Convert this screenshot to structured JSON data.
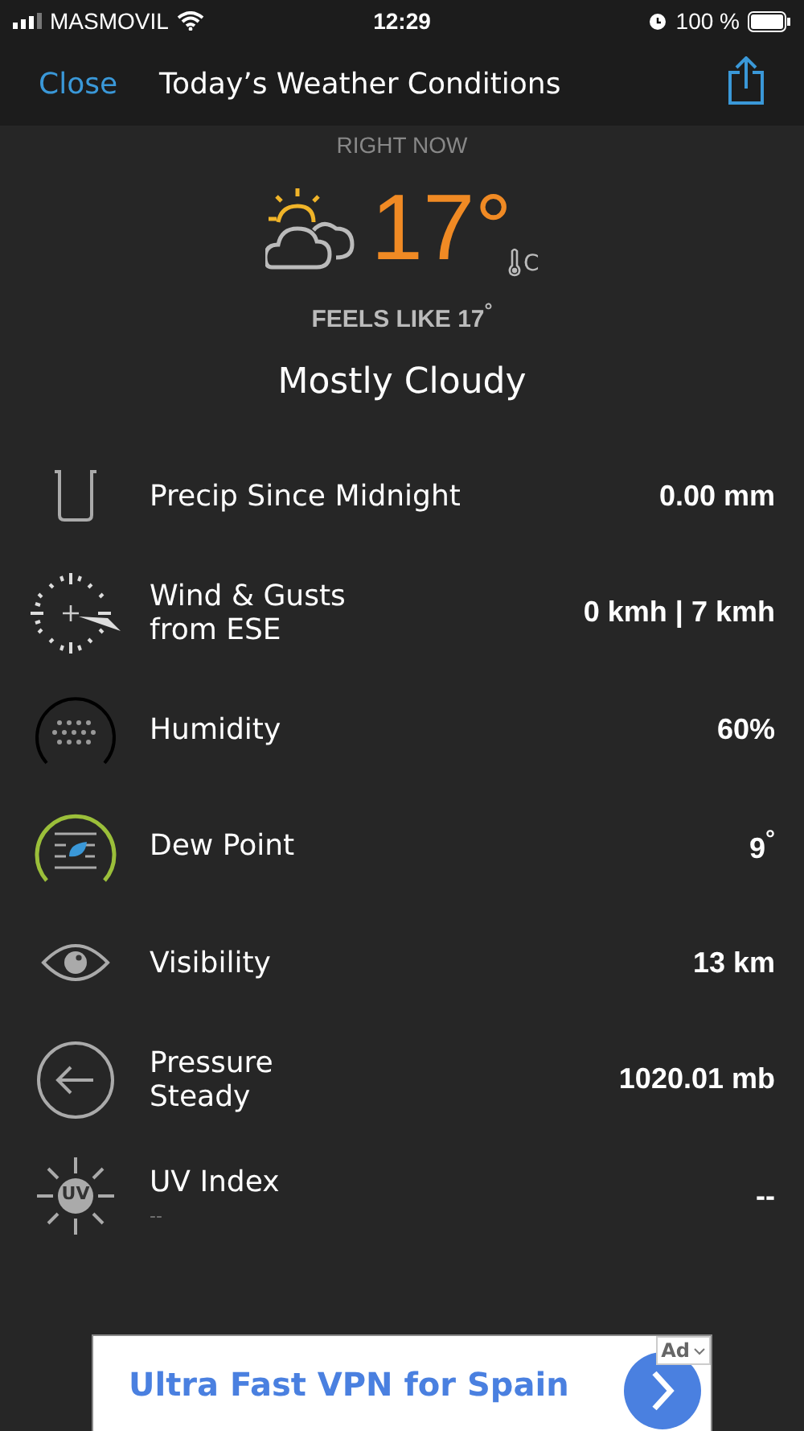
{
  "status_bar": {
    "carrier": "MASMOVIL",
    "time": "12:29",
    "battery": "100 %"
  },
  "nav": {
    "close": "Close",
    "title": "Today’s Weather Conditions"
  },
  "current": {
    "heading": "RIGHT NOW",
    "temperature": "17°",
    "unit": "C",
    "feels_like": "FEELS LIKE 17$^{°}$",
    "condition": "Mostly Cloudy"
  },
  "rows": [
    {
      "kind": "precip",
      "label": "Precip Since Midnight",
      "value": "0.00 mm"
    },
    {
      "kind": "wind",
      "label": "Wind & Gusts",
      "detail": "from ESE",
      "value": "0 kmh | 7 kmh"
    },
    {
      "kind": "humidity",
      "label": "Humidity",
      "value": "60%"
    },
    {
      "kind": "dewpoint",
      "label": "Dew Point",
      "value": "9$^{°}$"
    },
    {
      "kind": "visibility",
      "label": "Visibility",
      "value": "13 km"
    },
    {
      "kind": "pressure",
      "label": "Pressure",
      "detail": "Steady",
      "value": "1020.01 mb"
    },
    {
      "kind": "uv",
      "label": "UV Index",
      "note": "--",
      "value": "--",
      "icon_text": "UV"
    }
  ],
  "ad": {
    "text": "Ultra Fast VPN for Spain",
    "badge": "Ad"
  }
}
